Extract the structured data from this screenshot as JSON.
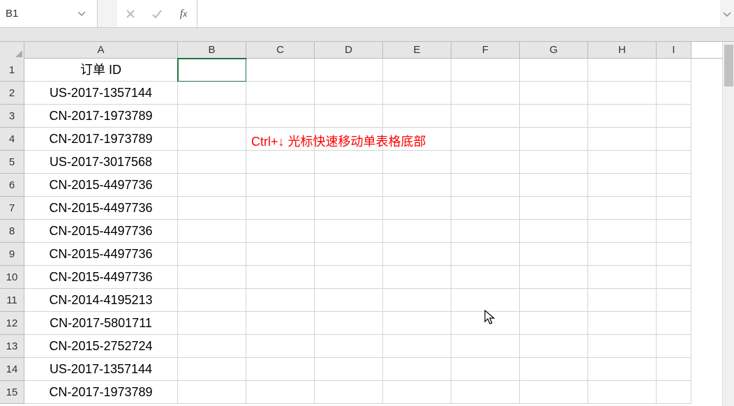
{
  "formula_bar": {
    "name_box_value": "B1",
    "formula_value": ""
  },
  "columns": [
    "A",
    "B",
    "C",
    "D",
    "E",
    "F",
    "G",
    "H",
    "I"
  ],
  "rows": [
    {
      "num": "1",
      "A": "订单 ID"
    },
    {
      "num": "2",
      "A": "US-2017-1357144"
    },
    {
      "num": "3",
      "A": "CN-2017-1973789"
    },
    {
      "num": "4",
      "A": "CN-2017-1973789"
    },
    {
      "num": "5",
      "A": "US-2017-3017568"
    },
    {
      "num": "6",
      "A": "CN-2015-4497736"
    },
    {
      "num": "7",
      "A": "CN-2015-4497736"
    },
    {
      "num": "8",
      "A": "CN-2015-4497736"
    },
    {
      "num": "9",
      "A": "CN-2015-4497736"
    },
    {
      "num": "10",
      "A": "CN-2015-4497736"
    },
    {
      "num": "11",
      "A": "CN-2014-4195213"
    },
    {
      "num": "12",
      "A": "CN-2017-5801711"
    },
    {
      "num": "13",
      "A": "CN-2015-2752724"
    },
    {
      "num": "14",
      "A": "US-2017-1357144"
    },
    {
      "num": "15",
      "A": "CN-2017-1973789"
    }
  ],
  "selected_cell": "B1",
  "annotation": {
    "text": "Ctrl+↓  光标快速移动单表格底部",
    "row": 4,
    "col": "C"
  }
}
